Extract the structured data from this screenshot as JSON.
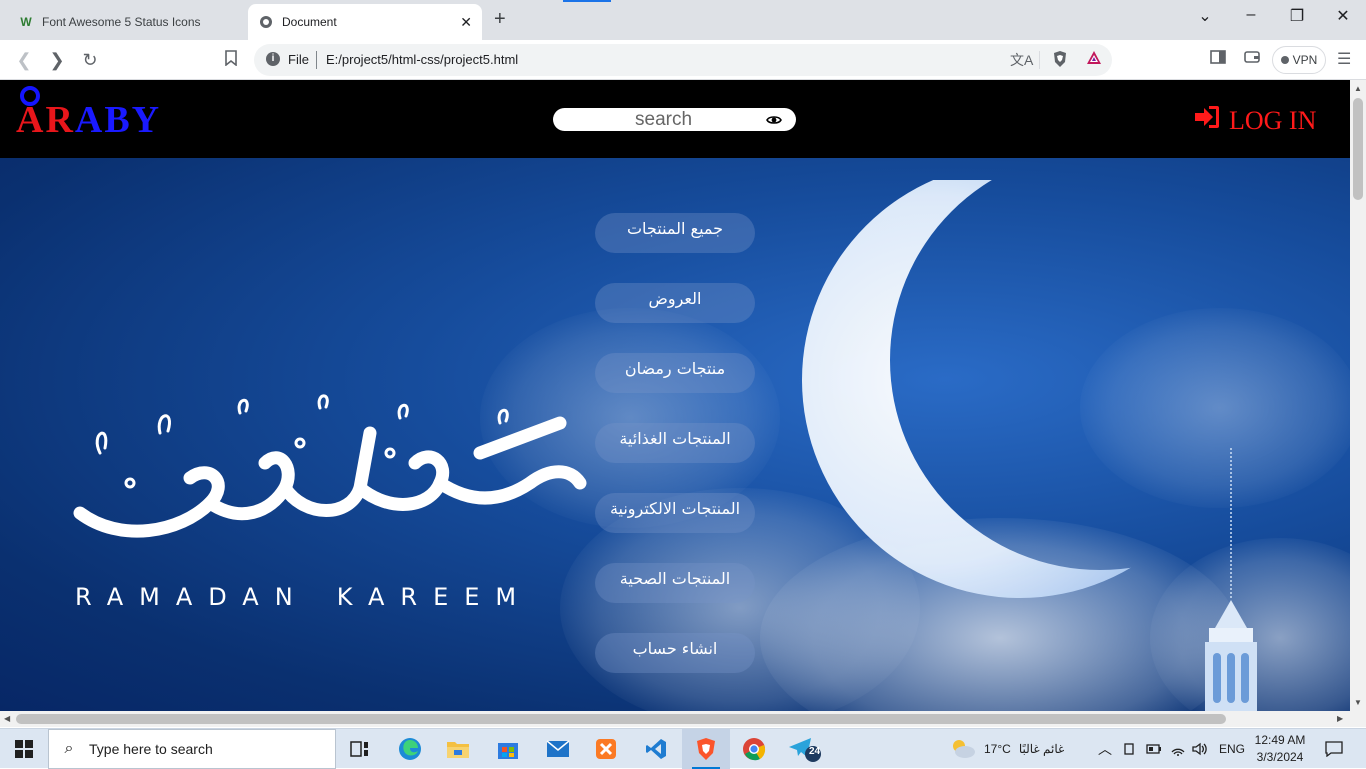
{
  "browser": {
    "tabs": [
      {
        "title": "Font Awesome 5 Status Icons",
        "icon": "w-favicon-icon",
        "active": false
      },
      {
        "title": "Document",
        "icon": "globe-icon",
        "active": true
      }
    ],
    "address": {
      "scheme": "File",
      "url": "E:/project5/html-css/project5.html"
    },
    "vpn_label": "VPN"
  },
  "page": {
    "logo": {
      "red_part": "AR",
      "blue_part": "ABY"
    },
    "search": {
      "placeholder": "search"
    },
    "login_label": "LOG IN",
    "menu": [
      "جميع المنتجات",
      "العروض",
      "منتجات رمضان",
      "المنتجات الغذائية",
      "المنتجات الالكترونية",
      "المنتجات الصحية",
      "انشاء حساب"
    ],
    "hero": {
      "ramadan_word_1": "RAMADAN",
      "ramadan_word_2": "KAREEM",
      "colors": {
        "sky": "#164c9c",
        "logo_red": "#e8161b",
        "logo_blue": "#1a1aff",
        "login_red": "#ff1a1a"
      }
    }
  },
  "taskbar": {
    "search_placeholder": "Type here to search",
    "weather_temp": "17°C",
    "weather_text": "غائم غالبًا",
    "language": "ENG",
    "time": "12:49 AM",
    "date": "3/3/2024",
    "telegram_badge": "24"
  }
}
